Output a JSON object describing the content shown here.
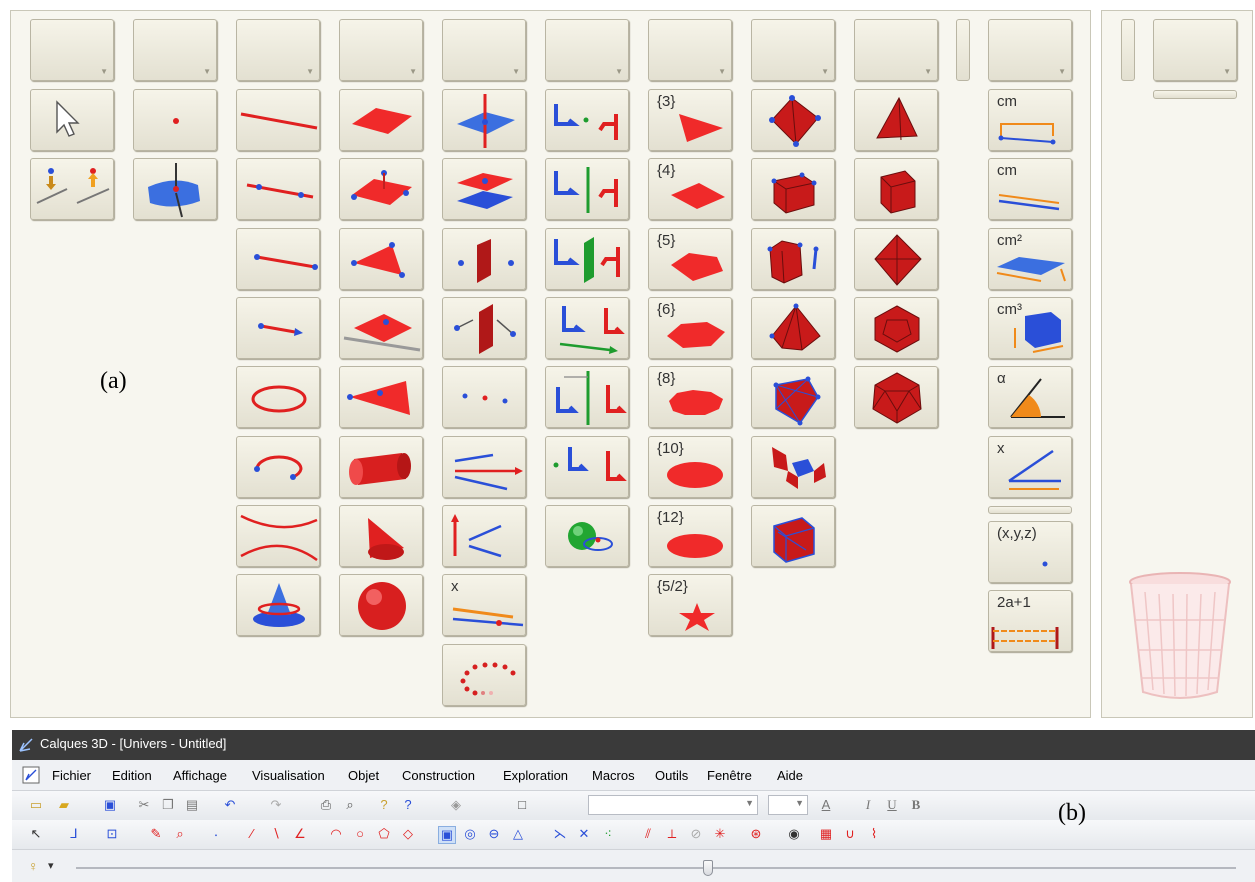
{
  "figure_labels": {
    "a": "(a)",
    "b": "(b)"
  },
  "window": {
    "title": "Calques 3D - [Univers - Untitled]"
  },
  "menu": [
    "Fichier",
    "Edition",
    "Affichage",
    "Visualisation",
    "Objet",
    "Construction",
    "Exploration",
    "Macros",
    "Outils",
    "Fenêtre",
    "Aide"
  ],
  "palette": {
    "polygon_labels": [
      "{3}",
      "{4}",
      "{5}",
      "{6}",
      "{8}",
      "{10}",
      "{12}",
      "{5/2}"
    ],
    "measure_labels": [
      "cm",
      "cm",
      "cm²",
      "cm³",
      "α",
      "x",
      "(x,y,z)",
      "2a+1"
    ],
    "vector_label": "x",
    "header_dropdown_glyph": "▼"
  },
  "colors": {
    "red": "#e02020",
    "blue": "#2a4fd8",
    "green": "#1e9c2e",
    "orange": "#f08a1a",
    "button": "#ebe8db",
    "titlebar": "#3a3a3a"
  },
  "toolbar": {
    "combo1": "",
    "combo2": "",
    "combo3": "",
    "combo4": "",
    "zoom_glyph": "▾"
  },
  "trash_icon": "trash-can-icon"
}
